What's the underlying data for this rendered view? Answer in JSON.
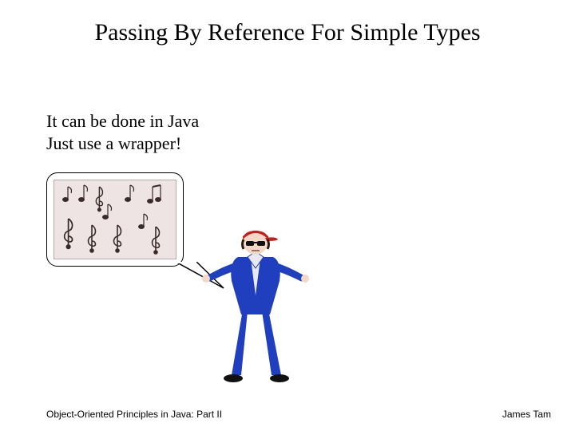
{
  "title": "Passing By Reference For Simple Types",
  "body": {
    "line1": "It can be done in Java",
    "line2": "Just use a wrapper!"
  },
  "footer": {
    "left": "Object-Oriented Principles in Java: Part II",
    "right": "James Tam"
  },
  "graphics": {
    "bubble_icon": "music-notes-icon",
    "figure_icon": "person-shrugging-icon"
  }
}
